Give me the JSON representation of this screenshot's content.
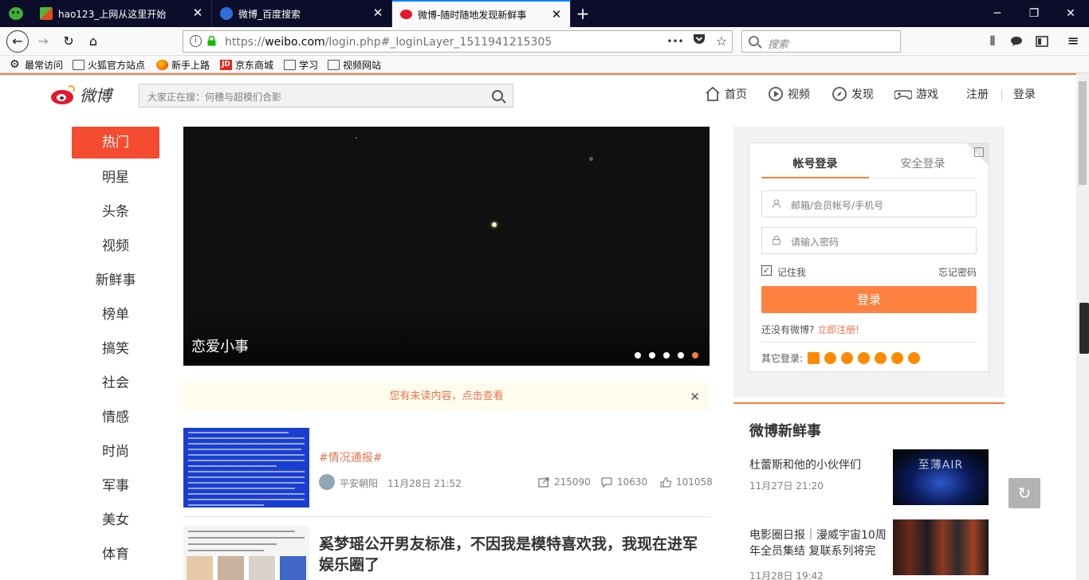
{
  "browser": {
    "tabs": [
      {
        "title": "hao123_上网从这里开始",
        "active": false
      },
      {
        "title": "微博_百度搜索",
        "active": false
      },
      {
        "title": "微博-随时随地发现新鲜事",
        "active": true
      }
    ],
    "url": {
      "scheme": "https://",
      "host": "weibo.com",
      "path": "/login.php#_loginLayer_1511941215305"
    },
    "search_placeholder": "搜索",
    "page_actions": {
      "more": "•••"
    },
    "bookmarks": [
      "最常访问",
      "火狐官方站点",
      "新手上路",
      "京东商城",
      "学习",
      "视频网站"
    ]
  },
  "weibo": {
    "logo_text": "微博",
    "search_placeholder": "大家正在搜：何穗与超模们合影",
    "topnav": [
      "首页",
      "视频",
      "发现",
      "游戏",
      "注册",
      "登录"
    ],
    "leftnav": [
      "热门",
      "明星",
      "头条",
      "视频",
      "新鲜事",
      "榜单",
      "搞笑",
      "社会",
      "情感",
      "时尚",
      "军事",
      "美女",
      "体育"
    ],
    "banner_caption": "恋爱小事",
    "notice": "您有未读内容，点击查看",
    "feed": [
      {
        "tag": "#情况通报#",
        "source": "平安朝阳",
        "time": "11月28日 21:52",
        "reposts": "215090",
        "comments": "10630",
        "likes": "101058"
      },
      {
        "title": "奚梦瑶公开男友标准，不因我是模特喜欢我，我现在进军娱乐圈了"
      }
    ],
    "login": {
      "tab_account": "帐号登录",
      "tab_secure": "安全登录",
      "user_placeholder": "邮箱/会员帐号/手机号",
      "pass_placeholder": "请输入密码",
      "remember": "记住我",
      "forgot": "忘记密码",
      "button": "登录",
      "no_account": "还没有微博?",
      "register_link": "立即注册!",
      "other_login": "其它登录:"
    },
    "fresh": {
      "heading": "微博新鲜事",
      "items": [
        {
          "title": "杜蕾斯和他的小伙伴们",
          "time": "11月27日 21:20",
          "image_text": "至薄AIR"
        },
        {
          "title": "电影圈日报｜漫威宇宙10周年全员集结 复联系列将完",
          "time": "11月28日 19:42"
        }
      ]
    }
  }
}
